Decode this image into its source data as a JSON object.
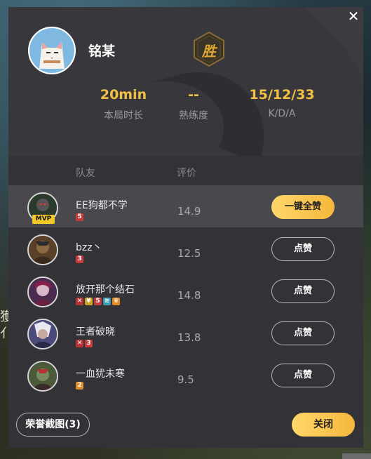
{
  "background": {
    "side_text_1": "獲",
    "side_text_2": "亻"
  },
  "dialog": {
    "close_glyph": "✕",
    "player": {
      "name": "铭某",
      "result_badge": "胜"
    },
    "stats": [
      {
        "value": "20min",
        "label": "本局时长"
      },
      {
        "value": "--",
        "label": "熟练度"
      },
      {
        "value": "15/12/33",
        "label": "K/D/A"
      }
    ],
    "columns": {
      "teammate": "队友",
      "rating": "评价"
    },
    "teammates": [
      {
        "name": "EE狗都不学",
        "rating": "14.9",
        "button": "一键全赞",
        "mvp": "MVP",
        "hero_color": "#2b3a2a",
        "badges": [
          {
            "text": "5",
            "color": "#c93a3a"
          }
        ]
      },
      {
        "name": "bzz丶",
        "rating": "12.5",
        "button": "点赞",
        "hero_color": "#5a4028",
        "badges": [
          {
            "text": "3",
            "color": "#c93a3a"
          }
        ]
      },
      {
        "name": "放开那个结石",
        "rating": "14.8",
        "button": "点赞",
        "hero_color": "#4a2c4e",
        "badges": [
          {
            "text": "✕",
            "color": "#b23535"
          },
          {
            "text": "¥",
            "color": "#c9a227"
          },
          {
            "text": "5",
            "color": "#c93a3a"
          },
          {
            "text": "≋",
            "color": "#3e9ab0"
          },
          {
            "text": "♛",
            "color": "#e08a2a"
          }
        ]
      },
      {
        "name": "王者破晓",
        "rating": "13.8",
        "button": "点赞",
        "hero_color": "#4b4a7a",
        "badges": [
          {
            "text": "✕",
            "color": "#b23535"
          },
          {
            "text": "3",
            "color": "#c93a3a"
          }
        ]
      },
      {
        "name": "一血犹未寒",
        "rating": "9.5",
        "button": "点赞",
        "hero_color": "#4a5a3a",
        "badges": [
          {
            "text": "2",
            "color": "#e08a2a"
          }
        ]
      }
    ],
    "footer": {
      "screenshot_button": "荣誉截图(3)",
      "close_button": "关闭"
    },
    "colors": {
      "accent_gold": "#f2c043",
      "panel_bg": "#333236",
      "highlight_row": "#49484c"
    }
  }
}
